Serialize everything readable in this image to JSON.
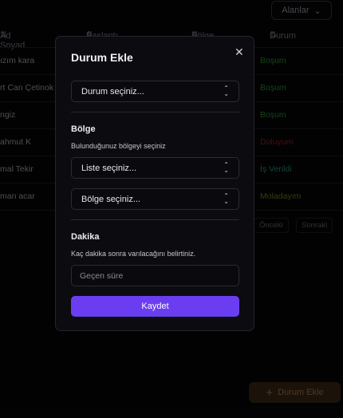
{
  "background": {
    "filter_label": "Alanlar",
    "columns": [
      "Ad Soyad",
      "Başlantı",
      "Bölge",
      "Durum"
    ],
    "rows": [
      {
        "name": "ızım kara",
        "status": "Boşum",
        "status_color": "#1f6b1f"
      },
      {
        "name": "rt Can Çetinok",
        "status": "Boşum",
        "status_color": "#1f6b1f"
      },
      {
        "name": "ngiz",
        "status": "Boşum",
        "status_color": "#1f6b1f"
      },
      {
        "name": "ahmut K",
        "status": "Doluyum",
        "status_color": "#6b1a1a"
      },
      {
        "name": "mal Tekir",
        "status": "İş Verildi",
        "status_color": "#1d6a5a"
      },
      {
        "name": "man acar",
        "status": "Moladayım",
        "status_color": "#5a5a1a"
      }
    ],
    "prev_label": "Önceki",
    "next_label": "Sonraki",
    "fab_label": "Durum Ekle"
  },
  "modal": {
    "title": "Durum Ekle",
    "status_select": "Durum seçiniz...",
    "region_title": "Bölge",
    "region_hint": "Bulunduğunuz bölgeyi seçiniz",
    "list_select": "Liste seçiniz...",
    "region_select": "Bölge seçiniz...",
    "minute_title": "Dakika",
    "minute_hint": "Kaç dakika sonra varılacağını belirtiniz.",
    "minute_placeholder": "Geçen süre",
    "save_label": "Kaydet"
  },
  "colors": {
    "accent": "#6a3ef0"
  }
}
